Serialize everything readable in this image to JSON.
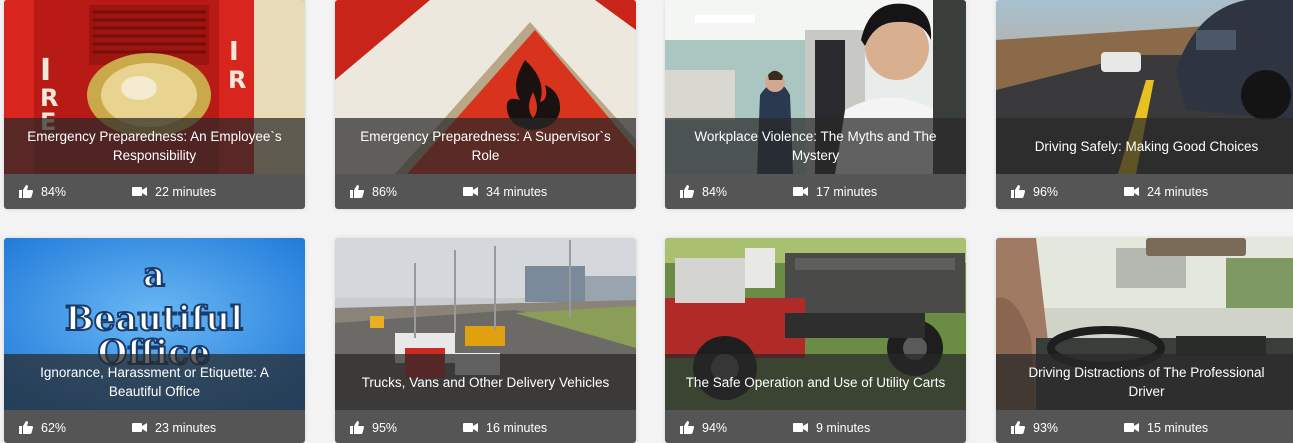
{
  "videos": [
    {
      "title": "Emergency Preparedness: An Employee`s Responsibility",
      "rating": "84%",
      "duration": "22 minutes",
      "thumb_colors": [
        "#c8201c",
        "#e8d8c0",
        "#b01914"
      ]
    },
    {
      "title": "Emergency Preparedness: A Supervisor`s Role",
      "rating": "86%",
      "duration": "34 minutes",
      "thumb_colors": [
        "#d23a1c",
        "#f0ece4",
        "#c0301a"
      ]
    },
    {
      "title": "Workplace Violence: The Myths and The Mystery",
      "rating": "84%",
      "duration": "17 minutes",
      "thumb_colors": [
        "#9bb6b0",
        "#e6eae6",
        "#2c3a4c"
      ]
    },
    {
      "title": "Driving Safely: Making Good Choices",
      "rating": "96%",
      "duration": "24 minutes",
      "thumb_colors": [
        "#b0703a",
        "#6b5848",
        "#2a2e36"
      ]
    },
    {
      "title": "Ignorance, Harassment or Etiquette: A Beautiful Office",
      "rating": "62%",
      "duration": "23 minutes",
      "thumb_colors": [
        "#2a88e0",
        "#58a8f0",
        "#ffffff"
      ]
    },
    {
      "title": "Trucks, Vans and Other Delivery Vehicles",
      "rating": "95%",
      "duration": "16 minutes",
      "thumb_colors": [
        "#c0c6cc",
        "#7a7a70",
        "#c8302a"
      ]
    },
    {
      "title": "The Safe Operation and Use of Utility Carts",
      "rating": "94%",
      "duration": "9 minutes",
      "thumb_colors": [
        "#7aa048",
        "#3a3a3a",
        "#b02a2a"
      ]
    },
    {
      "title": "Driving Distractions of The Professional Driver",
      "rating": "93%",
      "duration": "15 minutes",
      "thumb_colors": [
        "#c8c8c0",
        "#6a7a6a",
        "#3a3a3a"
      ]
    }
  ],
  "poster_text": [
    "a",
    "Beautiful",
    "Office"
  ]
}
